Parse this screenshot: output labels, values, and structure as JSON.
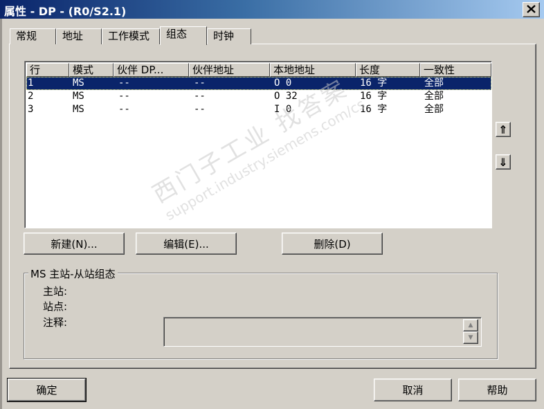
{
  "window": {
    "title": "属性 - DP - (R0/S2.1)",
    "close_label": "✕"
  },
  "tabs": [
    {
      "label": "常规"
    },
    {
      "label": "地址"
    },
    {
      "label": "工作模式"
    },
    {
      "label": "组态"
    },
    {
      "label": "时钟"
    }
  ],
  "active_tab": "组态",
  "table": {
    "columns": [
      "行",
      "模式",
      "伙伴 DP...",
      "伙伴地址",
      "本地地址",
      "长度",
      "一致性"
    ],
    "rows": [
      [
        "1",
        "MS",
        "--",
        "--",
        "O 0",
        "16 字",
        "全部"
      ],
      [
        "2",
        "MS",
        "--",
        "--",
        "O 32",
        "16 字",
        "全部"
      ],
      [
        "3",
        "MS",
        "--",
        "--",
        "I 0",
        "16 字",
        "全部"
      ]
    ],
    "selected_row": 1
  },
  "side_buttons": {
    "up": "⇑",
    "down": "⇓"
  },
  "actions": {
    "new": "新建(N)...",
    "edit": "编辑(E)...",
    "delete": "删除(D)"
  },
  "group": {
    "title": "MS 主站-从站组态",
    "master_label": "主站:",
    "station_label": "站点:",
    "comment_label": "注释:",
    "comment_value": ""
  },
  "footer": {
    "ok": "确定",
    "cancel": "取消",
    "help": "帮助"
  },
  "watermark": {
    "line1": "西门子工业  找答案",
    "line2": "support.industry.siemens.com/cs"
  }
}
